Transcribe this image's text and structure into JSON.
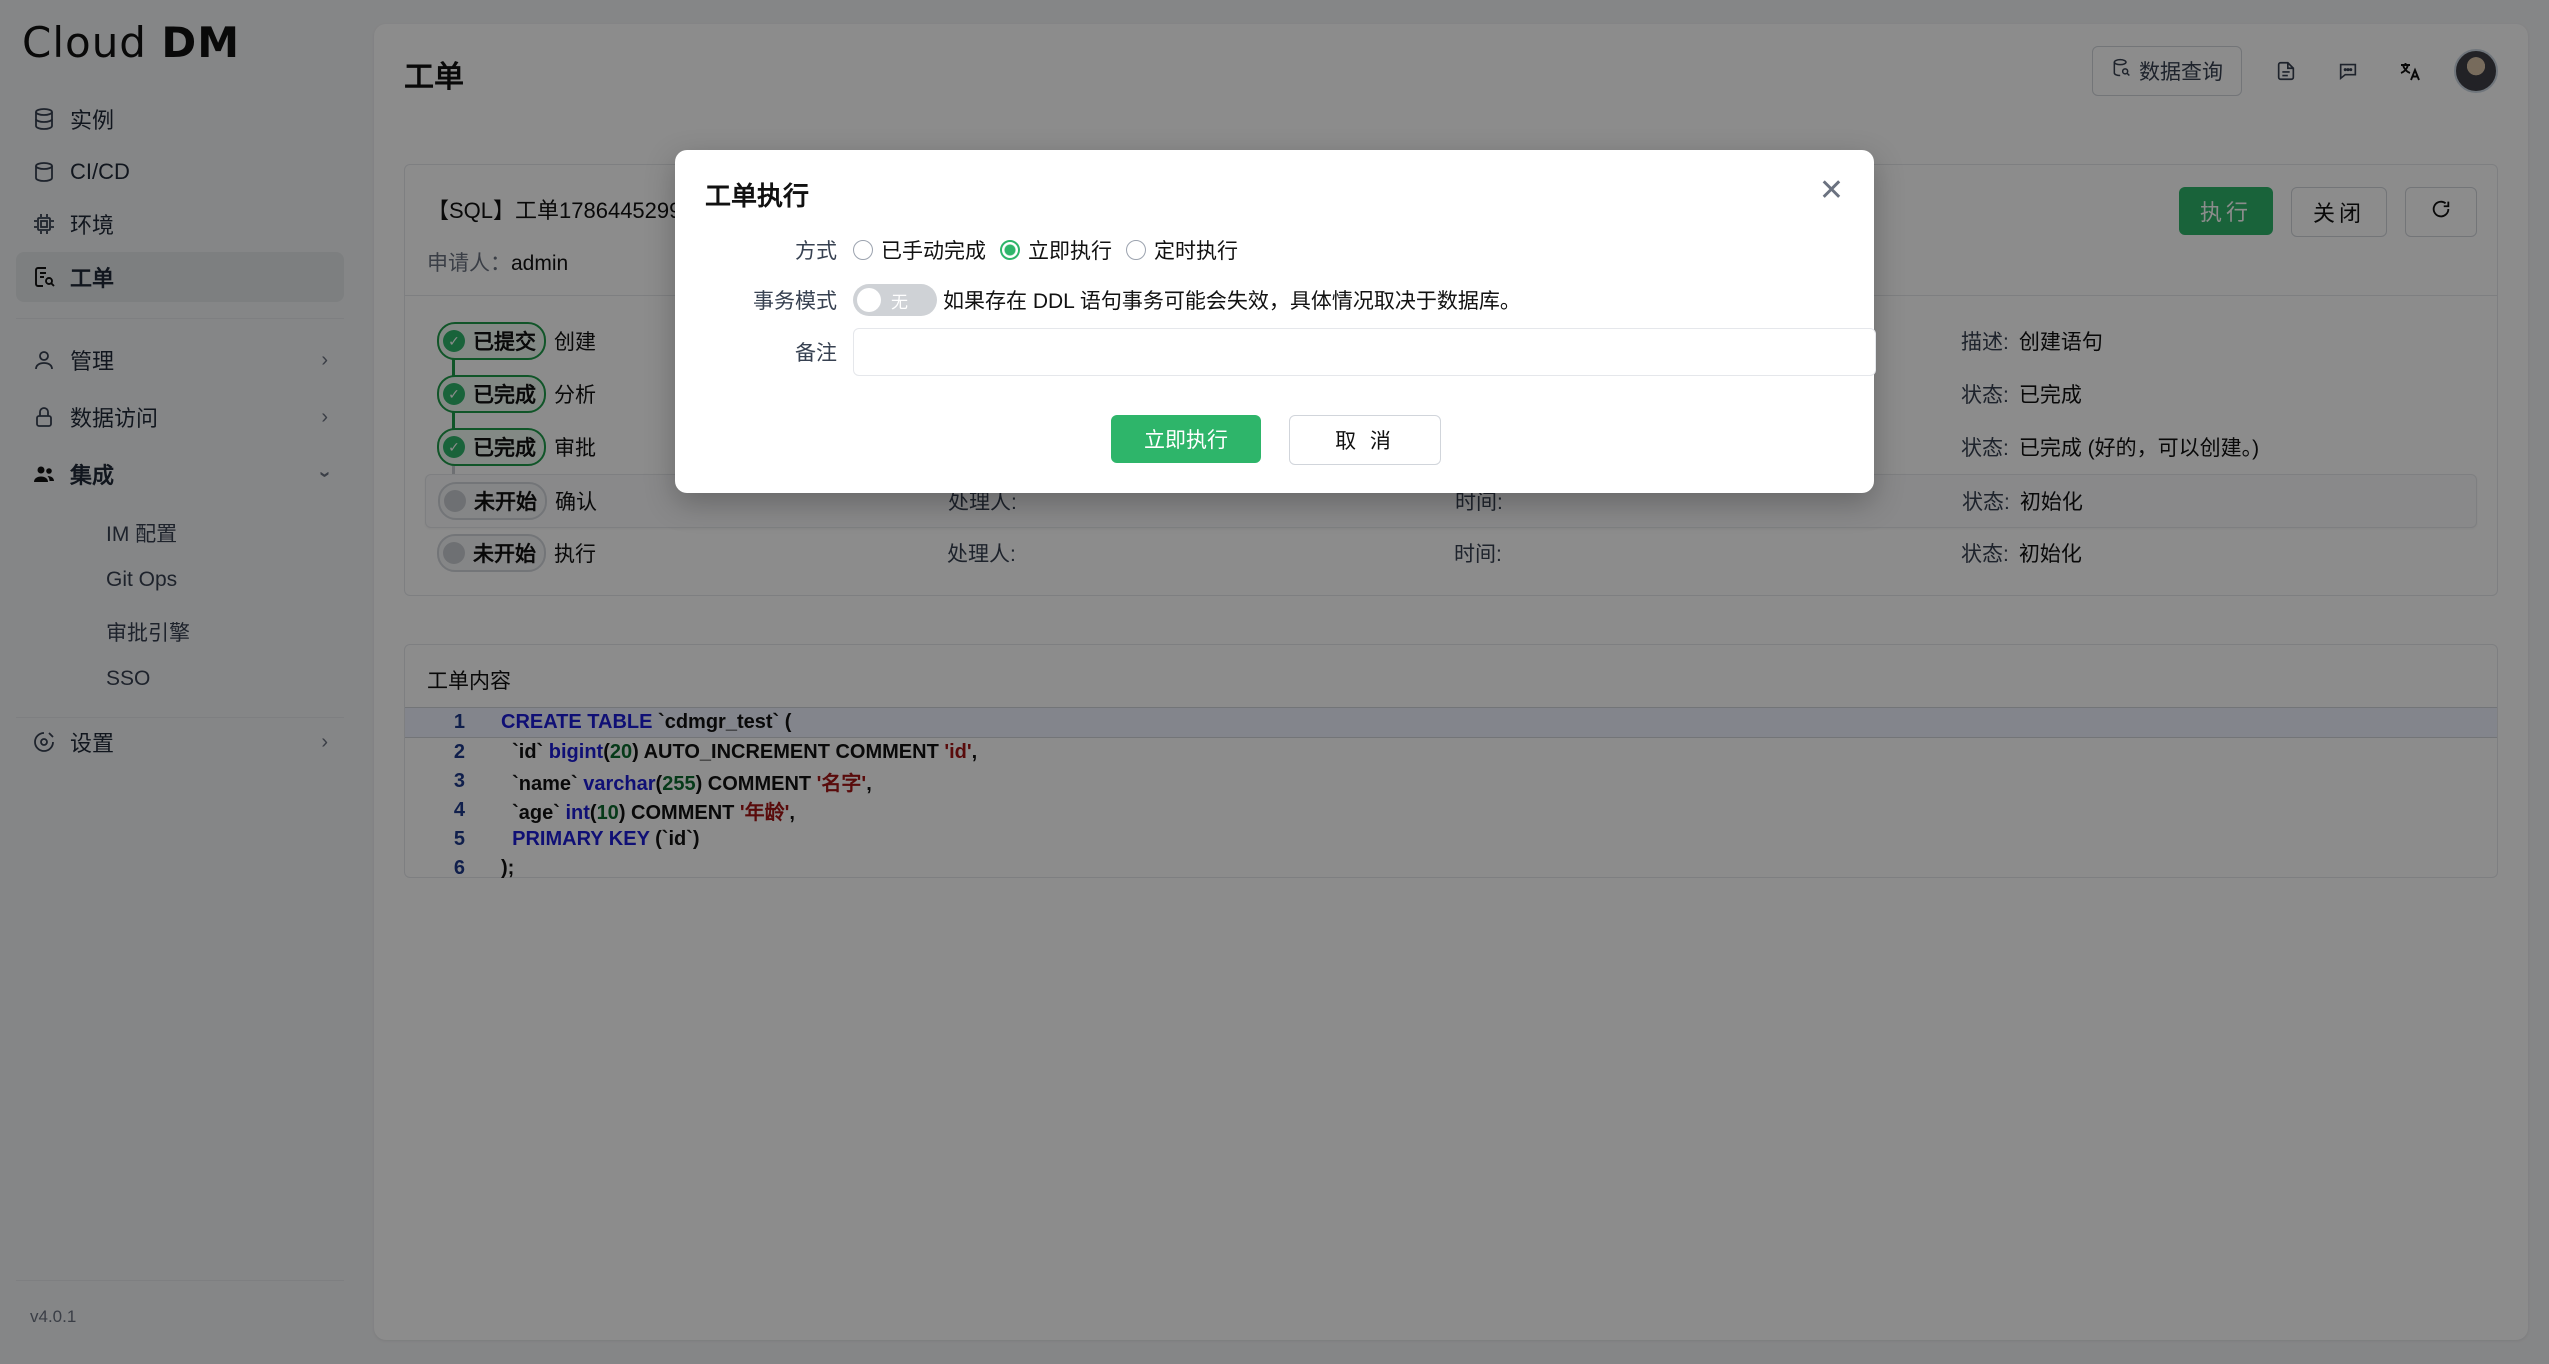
{
  "app": {
    "logo_light": "Cloud",
    "logo_bold": "DM",
    "version": "v4.0.1"
  },
  "sidebar": {
    "items": [
      {
        "label": "实例"
      },
      {
        "label": "CI/CD"
      },
      {
        "label": "环境"
      },
      {
        "label": "工单"
      },
      {
        "label": "管理"
      },
      {
        "label": "数据访问"
      },
      {
        "label": "集成"
      },
      {
        "label": "设置"
      }
    ],
    "sub_items": [
      "IM 配置",
      "Git Ops",
      "审批引擎",
      "SSO"
    ]
  },
  "header": {
    "title": "工单",
    "db_query_label": "数据查询"
  },
  "ticket": {
    "title": "【SQL】工单1786445299",
    "applicant_label": "申请人：",
    "applicant": "admin",
    "execute_label": "执行",
    "close_label": "关闭"
  },
  "steps": [
    {
      "status": "已提交",
      "name": "创建",
      "c4k": "描述:",
      "c4v": "创建语句"
    },
    {
      "status": "已完成",
      "name": "分析",
      "c4k": "状态:",
      "c4v": "已完成"
    },
    {
      "status": "已完成",
      "name": "审批",
      "c4k": "状态:",
      "c4v": "已完成 (好的，可以创建。)"
    },
    {
      "status": "未开始",
      "name": "确认",
      "c2k": "处理人:",
      "c3k": "时间:",
      "c4k": "状态:",
      "c4v": "初始化"
    },
    {
      "status": "未开始",
      "name": "执行",
      "c2k": "处理人:",
      "c3k": "时间:",
      "c4k": "状态:",
      "c4v": "初始化"
    }
  ],
  "content": {
    "title": "工单内容",
    "line_numbers": [
      "1",
      "2",
      "3",
      "4",
      "5",
      "6"
    ],
    "tokens": {
      "l1a": "CREATE TABLE",
      "l1b": " `cdmgr_test` (",
      "l2a": "  `id` ",
      "l2b": "bigint",
      "l2c": "(",
      "l2d": "20",
      "l2e": ") AUTO_INCREMENT COMMENT ",
      "l2f": "'id'",
      "l2g": ",",
      "l3a": "  `name` ",
      "l3b": "varchar",
      "l3c": "(",
      "l3d": "255",
      "l3e": ") COMMENT ",
      "l3f": "'名字'",
      "l3g": ",",
      "l4a": "  `age` ",
      "l4b": "int",
      "l4c": "(",
      "l4d": "10",
      "l4e": ") COMMENT ",
      "l4f": "'年龄'",
      "l4g": ",",
      "l5a": "  ",
      "l5b": "PRIMARY KEY",
      "l5c": " (`id`)",
      "l6a": ");"
    }
  },
  "modal": {
    "title": "工单执行",
    "method_label": "方式",
    "method_options": [
      "已手动完成",
      "立即执行",
      "定时执行"
    ],
    "method_selected": "立即执行",
    "tx_label": "事务模式",
    "tx_toggle_text": "无",
    "tx_hint": "如果存在 DDL 语句事务可能会失效，具体情况取决于数据库。",
    "note_label": "备注",
    "note_value": "",
    "confirm_label": "立即执行",
    "cancel_label": "取 消"
  },
  "colors": {
    "accent": "#2eb56a",
    "overlay": "rgba(0,0,0,0.45)"
  }
}
